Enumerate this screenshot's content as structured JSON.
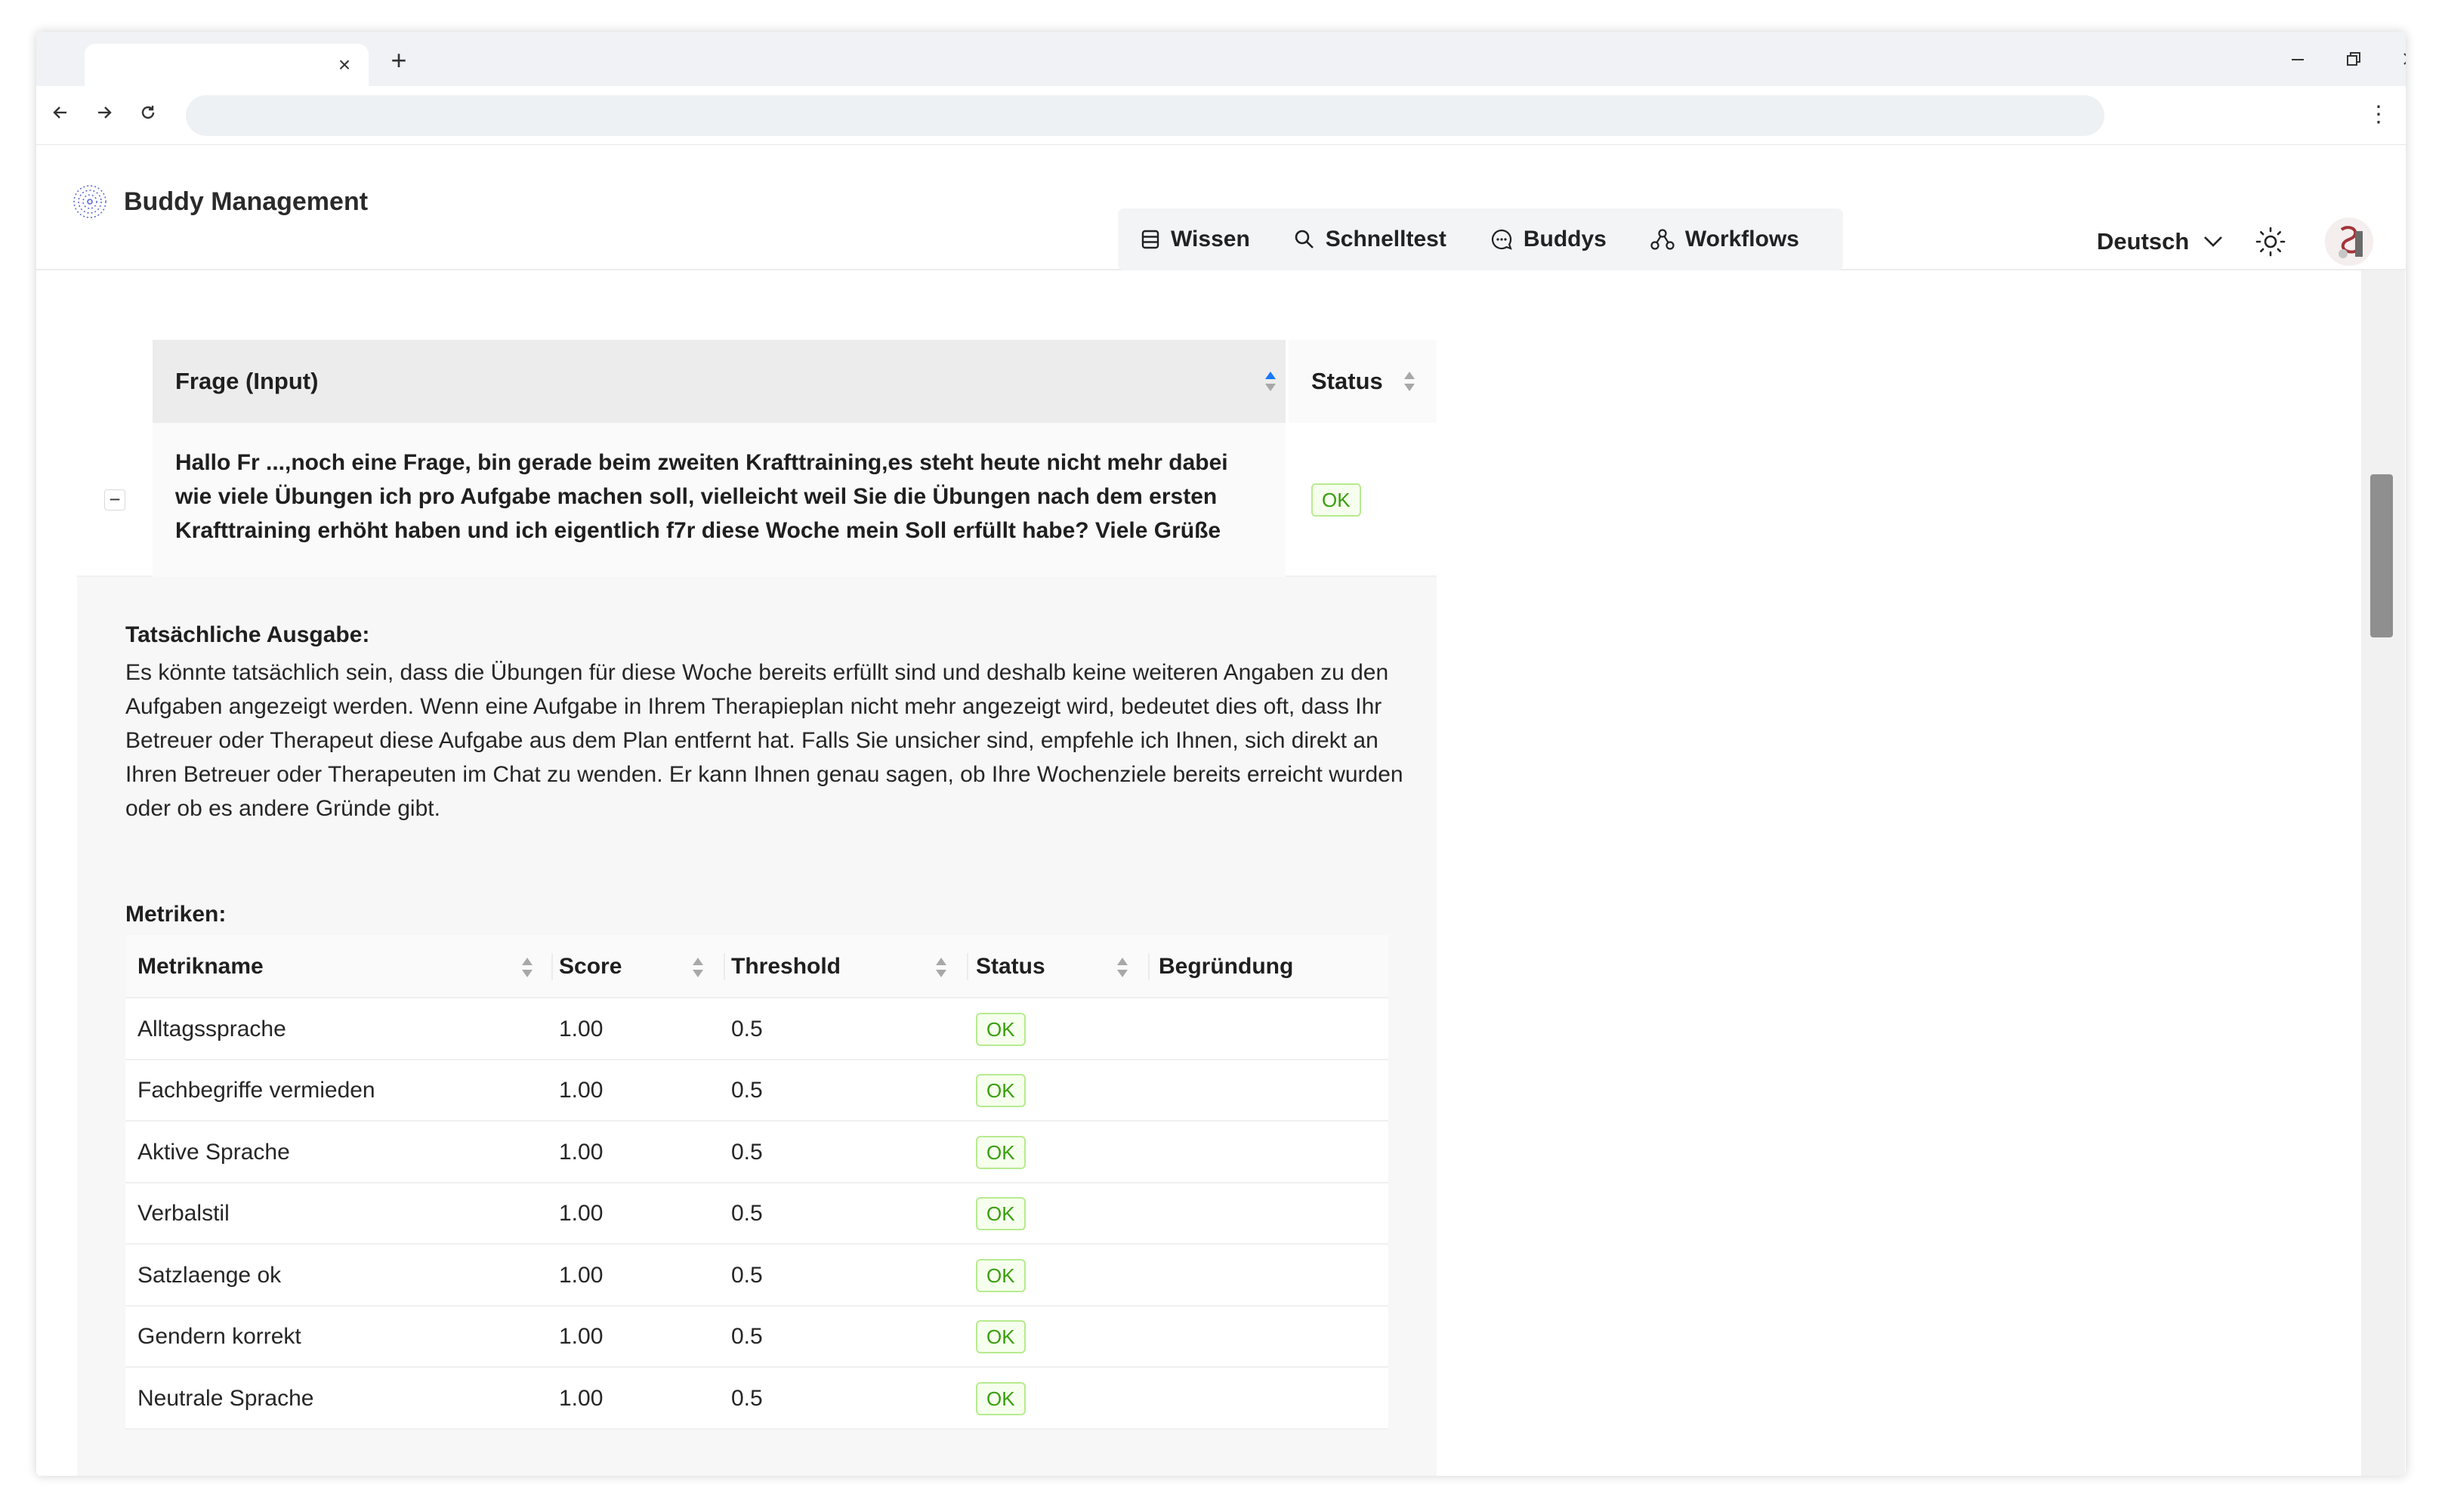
{
  "app": {
    "brand": "Buddy Management",
    "nav": [
      {
        "label": "Wissen",
        "icon": "database-icon"
      },
      {
        "label": "Schnelltest",
        "icon": "search-icon"
      },
      {
        "label": "Buddys",
        "icon": "chat-bubble-icon"
      },
      {
        "label": "Workflows",
        "icon": "workflow-icon"
      }
    ],
    "language": "Deutsch"
  },
  "browser": {
    "new_tab": "+",
    "tab_close": "×",
    "menu": "⋮"
  },
  "table": {
    "headers": {
      "question": "Frage (Input)",
      "status": "Status"
    },
    "row": {
      "question": "Hallo Fr ...,noch eine Frage, bin gerade beim zweiten Krafttraining,es steht heute nicht mehr dabei wie viele Übungen ich pro Aufgabe machen soll, vielleicht weil Sie die Übungen nach dem ersten Krafttraining erhöht haben und ich eigentlich f7r diese Woche mein Soll erfüllt habe? Viele Grüße",
      "status": "OK",
      "expand_symbol": "−"
    },
    "expanded": {
      "output_label": "Tatsächliche Ausgabe:",
      "output_text": "Es könnte tatsächlich sein, dass die Übungen für diese Woche bereits erfüllt sind und deshalb keine weiteren Angaben zu den Aufgaben angezeigt werden. Wenn eine Aufgabe in Ihrem Therapieplan nicht mehr angezeigt wird, bedeutet dies oft, dass Ihr Betreuer oder Therapeut diese Aufgabe aus dem Plan entfernt hat. Falls Sie unsicher sind, empfehle ich Ihnen, sich direkt an Ihren Betreuer oder Therapeuten im Chat zu wenden. Er kann Ihnen genau sagen, ob Ihre Wochenziele bereits erreicht wurden oder ob es andere Gründe gibt.",
      "metrics_label": "Metriken:",
      "metric_headers": {
        "name": "Metrikname",
        "score": "Score",
        "threshold": "Threshold",
        "status": "Status",
        "reason": "Begründung"
      },
      "metrics": [
        {
          "name": "Alltagssprache",
          "score": "1.00",
          "threshold": "0.5",
          "status": "OK"
        },
        {
          "name": "Fachbegriffe vermieden",
          "score": "1.00",
          "threshold": "0.5",
          "status": "OK"
        },
        {
          "name": "Aktive Sprache",
          "score": "1.00",
          "threshold": "0.5",
          "status": "OK"
        },
        {
          "name": "Verbalstil",
          "score": "1.00",
          "threshold": "0.5",
          "status": "OK"
        },
        {
          "name": "Satzlaenge ok",
          "score": "1.00",
          "threshold": "0.5",
          "status": "OK"
        },
        {
          "name": "Gendern korrekt",
          "score": "1.00",
          "threshold": "0.5",
          "status": "OK"
        },
        {
          "name": "Neutrale Sprache",
          "score": "1.00",
          "threshold": "0.5",
          "status": "OK"
        }
      ]
    }
  },
  "colors": {
    "ok_text": "#389e0d",
    "ok_border": "#b7eb8f",
    "ok_bg": "#f6ffed",
    "sort_active": "#1677ff"
  }
}
